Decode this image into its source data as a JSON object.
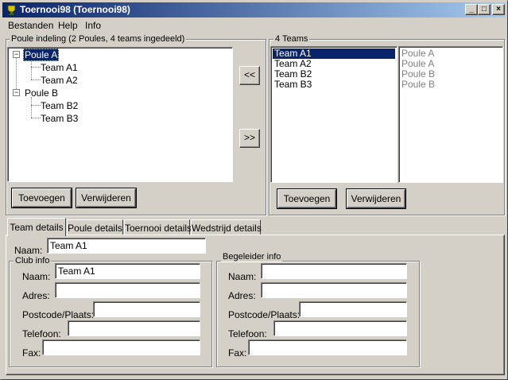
{
  "window": {
    "title": "Toernooi98 (Toernooi98)",
    "min": "_",
    "max": "□",
    "close": "×"
  },
  "menu": [
    "Bestanden",
    "Help",
    "Info"
  ],
  "poule_group": {
    "label": "Poule indeling (2 Poules, 4 teams ingedeeld)",
    "expander_collapse": "−",
    "tree": [
      {
        "label": "Poule A",
        "children": [
          "Team A1",
          "Team A2"
        ]
      },
      {
        "label": "Poule B",
        "children": [
          "Team B2",
          "Team B3"
        ]
      }
    ],
    "add_label": "Toevoegen",
    "remove_label": "Verwijderen"
  },
  "move_left_label": "<<",
  "move_right_label": ">>",
  "teams_group": {
    "label": "4 Teams",
    "teams": [
      "Team A1",
      "Team A2",
      "Team B2",
      "Team B3"
    ],
    "poules": [
      "Poule A",
      "Poule A",
      "Poule B",
      "Poule B"
    ],
    "add_label": "Toevoegen",
    "remove_label": "Verwijderen"
  },
  "tabs": [
    "Team details",
    "Poule details",
    "Toernooi details",
    "Wedstrijd details"
  ],
  "team_details": {
    "naam_label": "Naam:",
    "naam_value": "Team A1",
    "club_info": {
      "label": "Club info",
      "naam_label": "Naam:",
      "naam_value": "Team A1",
      "adres_label": "Adres:",
      "adres_value": "",
      "postcode_label": "Postcode/Plaats:",
      "postcode_value": "",
      "telefoon_label": "Telefoon:",
      "telefoon_value": "",
      "fax_label": "Fax:",
      "fax_value": ""
    },
    "begeleider_info": {
      "label": "Begeleider info",
      "naam_label": "Naam:",
      "naam_value": "",
      "adres_label": "Adres:",
      "adres_value": "",
      "postcode_label": "Postcode/Plaats:",
      "postcode_value": "",
      "telefoon_label": "Telefoon:",
      "telefoon_value": "",
      "fax_label": "Fax:",
      "fax_value": ""
    }
  }
}
